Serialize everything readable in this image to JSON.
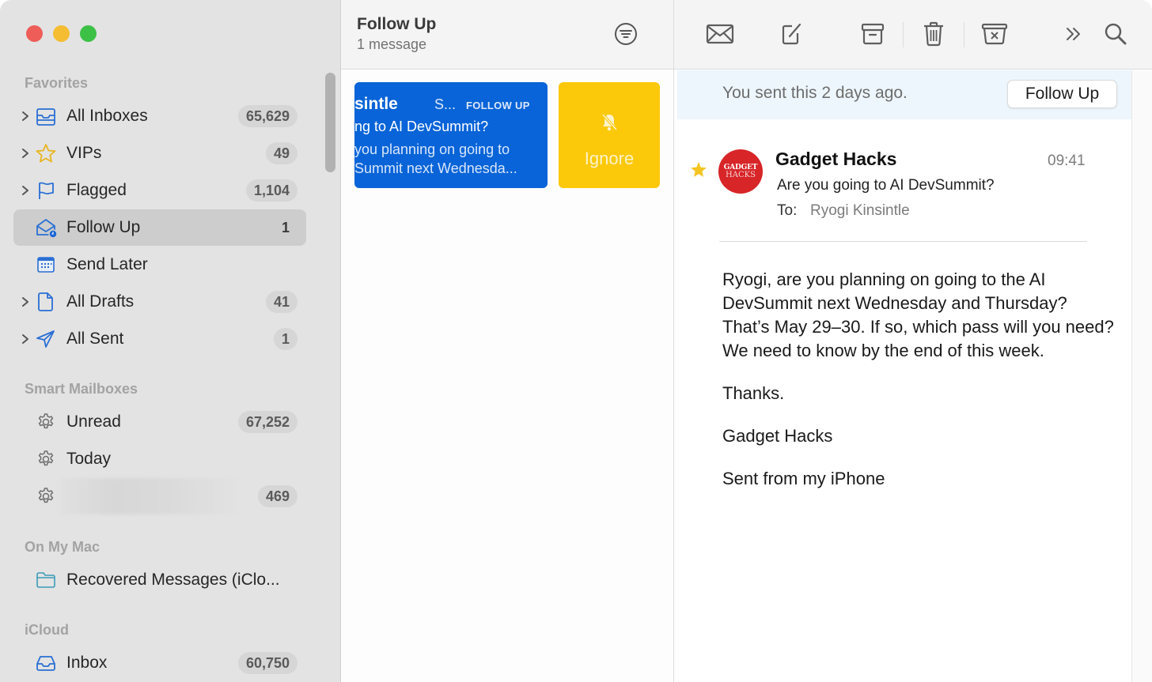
{
  "window": {
    "controls": [
      "close",
      "minimize",
      "zoom"
    ]
  },
  "sidebar": {
    "sections": [
      {
        "title": "Favorites"
      },
      {
        "title": "Smart Mailboxes"
      },
      {
        "title": "On My Mac"
      },
      {
        "title": "iCloud"
      }
    ],
    "favorites": [
      {
        "label": "All Inboxes",
        "count": "65,629",
        "icon": "tray-stack-icon",
        "expandable": true
      },
      {
        "label": "VIPs",
        "count": "49",
        "icon": "star-icon",
        "expandable": true
      },
      {
        "label": "Flagged",
        "count": "1,104",
        "icon": "flag-icon",
        "expandable": true
      },
      {
        "label": "Follow Up",
        "count": "1",
        "icon": "envelope-clock-icon",
        "expandable": false,
        "selected": true
      },
      {
        "label": "Send Later",
        "count": "",
        "icon": "calendar-icon",
        "expandable": false
      },
      {
        "label": "All Drafts",
        "count": "41",
        "icon": "document-icon",
        "expandable": true
      },
      {
        "label": "All Sent",
        "count": "1",
        "icon": "paper-plane-icon",
        "expandable": true
      }
    ],
    "smart_mailboxes": [
      {
        "label": "Unread",
        "count": "67,252",
        "icon": "gear-icon"
      },
      {
        "label": "Today",
        "count": "",
        "icon": "gear-icon"
      },
      {
        "label": "",
        "count": "469",
        "icon": "gear-icon",
        "redacted": true
      }
    ],
    "on_my_mac": [
      {
        "label": "Recovered Messages (iClo...",
        "icon": "folder-icon"
      }
    ],
    "icloud": [
      {
        "label": "Inbox",
        "count": "60,750",
        "icon": "inbox-tray-icon"
      }
    ]
  },
  "message_list": {
    "title": "Follow Up",
    "subtitle": "1 message",
    "messages": [
      {
        "sender": "sintle",
        "sender_suffix": "S...",
        "tag": "FOLLOW UP",
        "subject": "ng to AI DevSummit?",
        "preview_line1": "you planning on going to",
        "preview_line2": "Summit next Wednesda..."
      }
    ],
    "swipe_action": {
      "label": "Ignore",
      "icon": "bell-slash-icon"
    }
  },
  "toolbar": {
    "buttons": [
      "get-mail",
      "compose",
      "archive",
      "delete",
      "junk",
      "more",
      "search"
    ]
  },
  "reader": {
    "banner_text": "You sent this 2 days ago.",
    "follow_up_button": "Follow Up",
    "avatar_line1": "GADGET",
    "avatar_line2": "HACKS",
    "from": "Gadget Hacks",
    "time": "09:41",
    "subject": "Are you going to AI DevSummit?",
    "to_label": "To:",
    "to": "Ryogi Kinsintle",
    "body": [
      "Ryogi, are you planning on going to the AI DevSummit next Wednesday and Thursday? That’s May 29–30. If so, which pass will you need? We need to know by the end of this week.",
      "Thanks.",
      "Gadget Hacks",
      "Sent from my iPhone"
    ]
  },
  "colors": {
    "accent_blue": "#0864d8",
    "ignore_yellow": "#fcc80a",
    "avatar_red": "#d72528",
    "sidebar_bg": "#e3e3e3",
    "icon_blue": "#2a6fd4",
    "star_yellow": "#f4c522"
  }
}
